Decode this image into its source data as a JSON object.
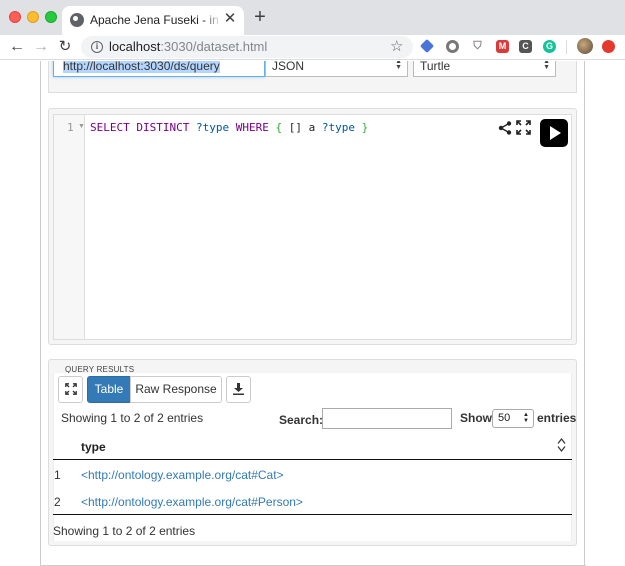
{
  "browser": {
    "tab_title": "Apache Jena Fuseki - inspect dataset",
    "tab_close": "✕",
    "new_tab": "+",
    "url_host": "localhost",
    "url_path": ":3030/dataset.html",
    "nav": {
      "back": "←",
      "forward": "→",
      "reload": "↻",
      "star": "☆"
    },
    "extensions": [
      "diamond-extension",
      "circle-extension",
      "shield-extension",
      "M",
      "C",
      "G",
      "profile-avatar",
      "red-extension"
    ]
  },
  "query_form": {
    "endpoint": "http://localhost:3030/ds/query",
    "format": "JSON",
    "output": "Turtle"
  },
  "editor": {
    "line_number": "1",
    "code_tokens": [
      {
        "cls": "kw",
        "text": "SELECT"
      },
      {
        "cls": "plain",
        "text": " "
      },
      {
        "cls": "kw",
        "text": "DISTINCT"
      },
      {
        "cls": "plain",
        "text": " "
      },
      {
        "cls": "var",
        "text": "?type"
      },
      {
        "cls": "plain",
        "text": " "
      },
      {
        "cls": "kw",
        "text": "WHERE"
      },
      {
        "cls": "plain",
        "text": " "
      },
      {
        "cls": "brace",
        "text": "{"
      },
      {
        "cls": "plain",
        "text": " [] a "
      },
      {
        "cls": "var",
        "text": "?type"
      },
      {
        "cls": "plain",
        "text": " "
      },
      {
        "cls": "brace",
        "text": "}"
      }
    ]
  },
  "results": {
    "legend": "QUERY RESULTS",
    "tab_table": "Table",
    "tab_raw": "Raw Response",
    "info_top": "Showing 1 to 2 of 2 entries",
    "search_label": "Search:",
    "show_label": "Show",
    "page_length": "50",
    "entries_label": "entries",
    "column_header": "type",
    "rows": [
      {
        "num": "1",
        "value": "<http://ontology.example.org/cat#Cat>"
      },
      {
        "num": "2",
        "value": "<http://ontology.example.org/cat#Person>"
      }
    ],
    "info_bottom": "Showing 1 to 2 of 2 entries"
  },
  "colors": {
    "primary": "#337ab7",
    "keyword": "#770088",
    "variable": "#0055aa",
    "brace": "#33aa33"
  }
}
